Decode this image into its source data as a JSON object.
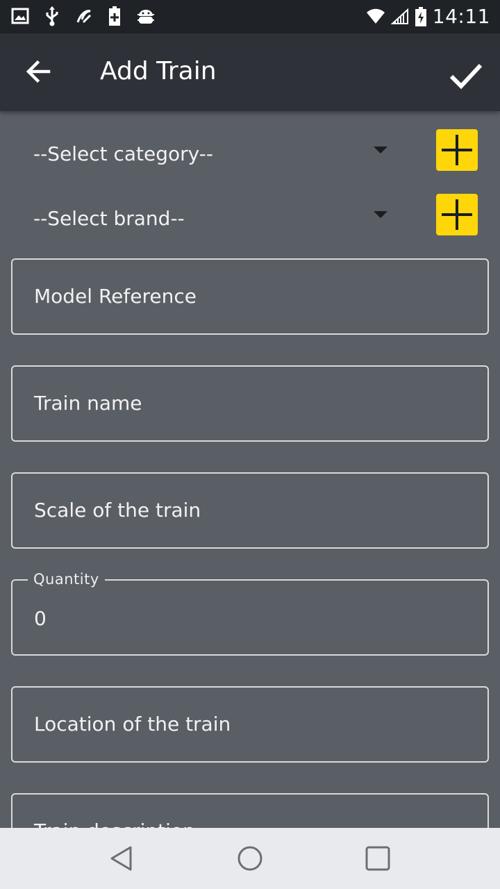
{
  "status_bar": {
    "time": "14:11",
    "icons": [
      "gallery-icon",
      "usb-icon",
      "sync-icon",
      "battery-plus-icon",
      "android-debug-icon",
      "wifi-icon",
      "signal-icon",
      "battery-charging-icon"
    ]
  },
  "app_bar": {
    "title": "Add Train",
    "back_icon": "arrow-back-icon",
    "confirm_icon": "check-icon"
  },
  "form": {
    "category_select": {
      "value": "--Select category--"
    },
    "brand_select": {
      "value": "--Select brand--"
    },
    "model_reference": {
      "placeholder": "Model Reference"
    },
    "train_name": {
      "placeholder": "Train name"
    },
    "scale": {
      "placeholder": "Scale of the train"
    },
    "quantity": {
      "label": "Quantity",
      "value": "0"
    },
    "location": {
      "placeholder": "Location of the train"
    },
    "description": {
      "placeholder": "Train description"
    }
  },
  "colors": {
    "background": "#5a5e65",
    "app_bar": "#2e3238",
    "status_bar": "#1f2226",
    "accent_add": "#ffd60a"
  },
  "nav_bar": {
    "icons": [
      "back-triangle-icon",
      "home-circle-icon",
      "recents-square-icon"
    ]
  }
}
